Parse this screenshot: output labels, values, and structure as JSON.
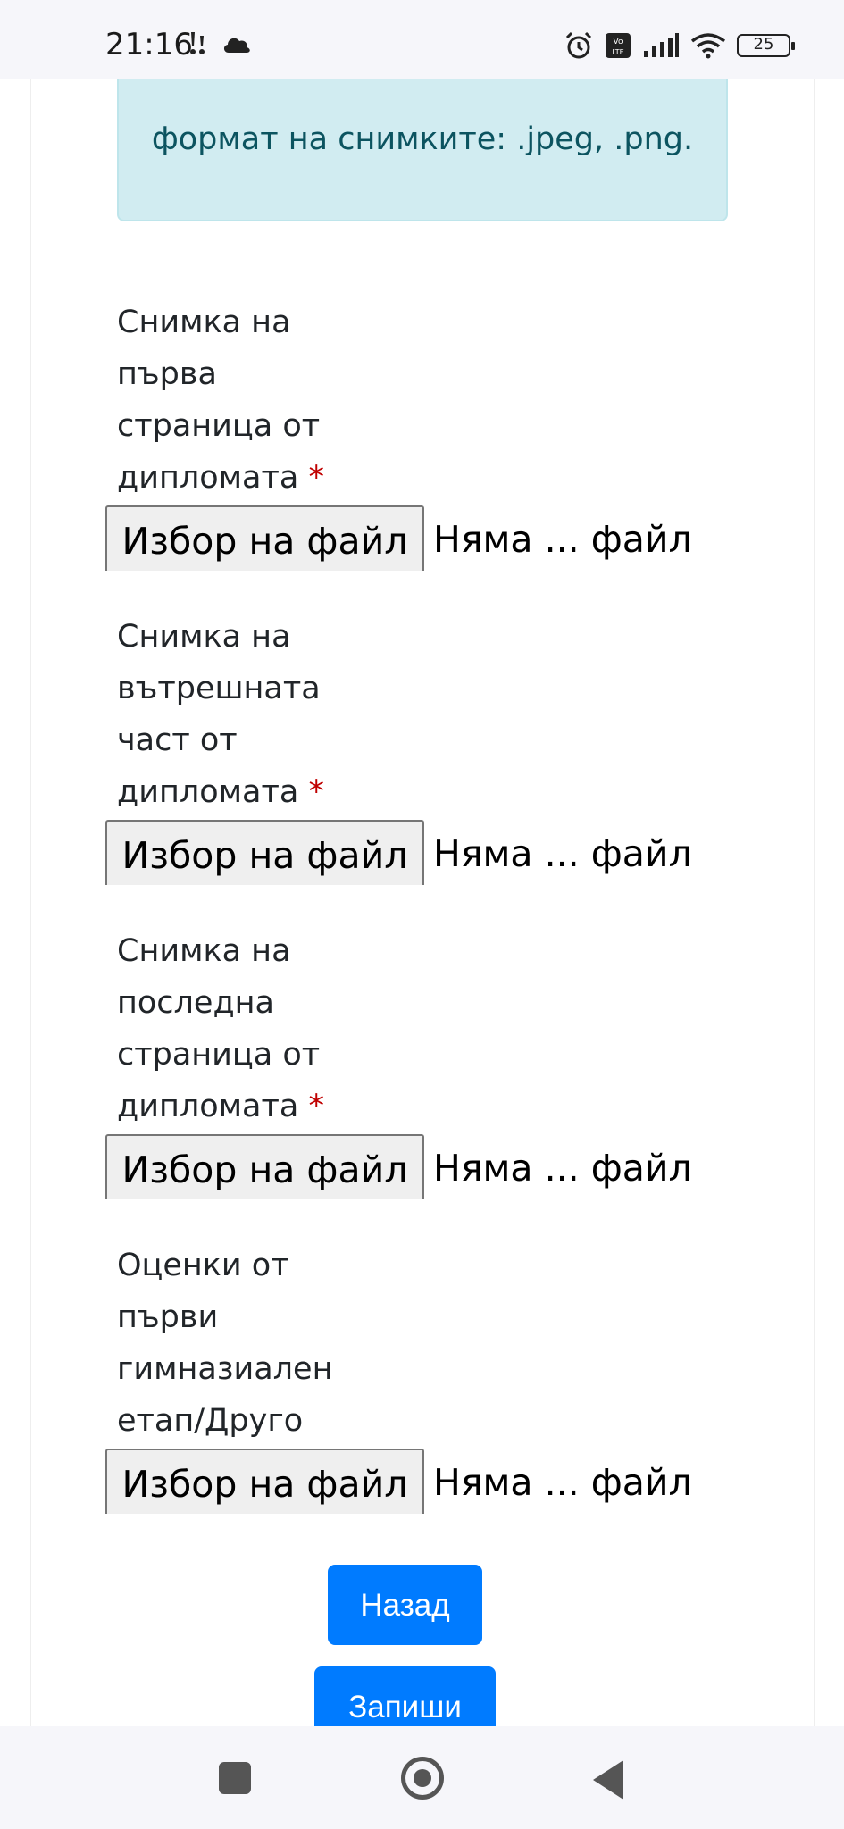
{
  "status_bar": {
    "time": "21:16",
    "battery": "25",
    "icons_left": [
      "notification-icon",
      "cloud-icon"
    ],
    "icons_right": [
      "alarm-icon",
      "volte-icon",
      "signal-icon",
      "wifi-icon",
      "battery-icon"
    ]
  },
  "info_alert": {
    "text": "формат на снимките: .jpeg, .png."
  },
  "fields": [
    {
      "label_lines": [
        "Снимка на",
        "първа",
        "страница от",
        "дипломата"
      ],
      "required": true,
      "button": "Избор на файл",
      "status": "Няма ... файл"
    },
    {
      "label_lines": [
        "Снимка на",
        "вътрешната",
        "част от",
        "дипломата"
      ],
      "required": true,
      "button": "Избор на файл",
      "status": "Няма ... файл"
    },
    {
      "label_lines": [
        "Снимка на",
        "последна",
        "страница от",
        "дипломата"
      ],
      "required": true,
      "button": "Избор на файл",
      "status": "Няма ... файл"
    },
    {
      "label_lines": [
        "Оценки от",
        "първи",
        "гимназиален",
        "етап/Друго"
      ],
      "required": false,
      "button": "Избор на файл",
      "status": "Няма ... файл"
    }
  ],
  "required_marker": "*",
  "buttons": {
    "back": "Назад",
    "save": "Запиши"
  },
  "colors": {
    "primary": "#007bff",
    "alert_bg": "#d1ecf1",
    "alert_text": "#0c5460",
    "required": "#c00000"
  }
}
